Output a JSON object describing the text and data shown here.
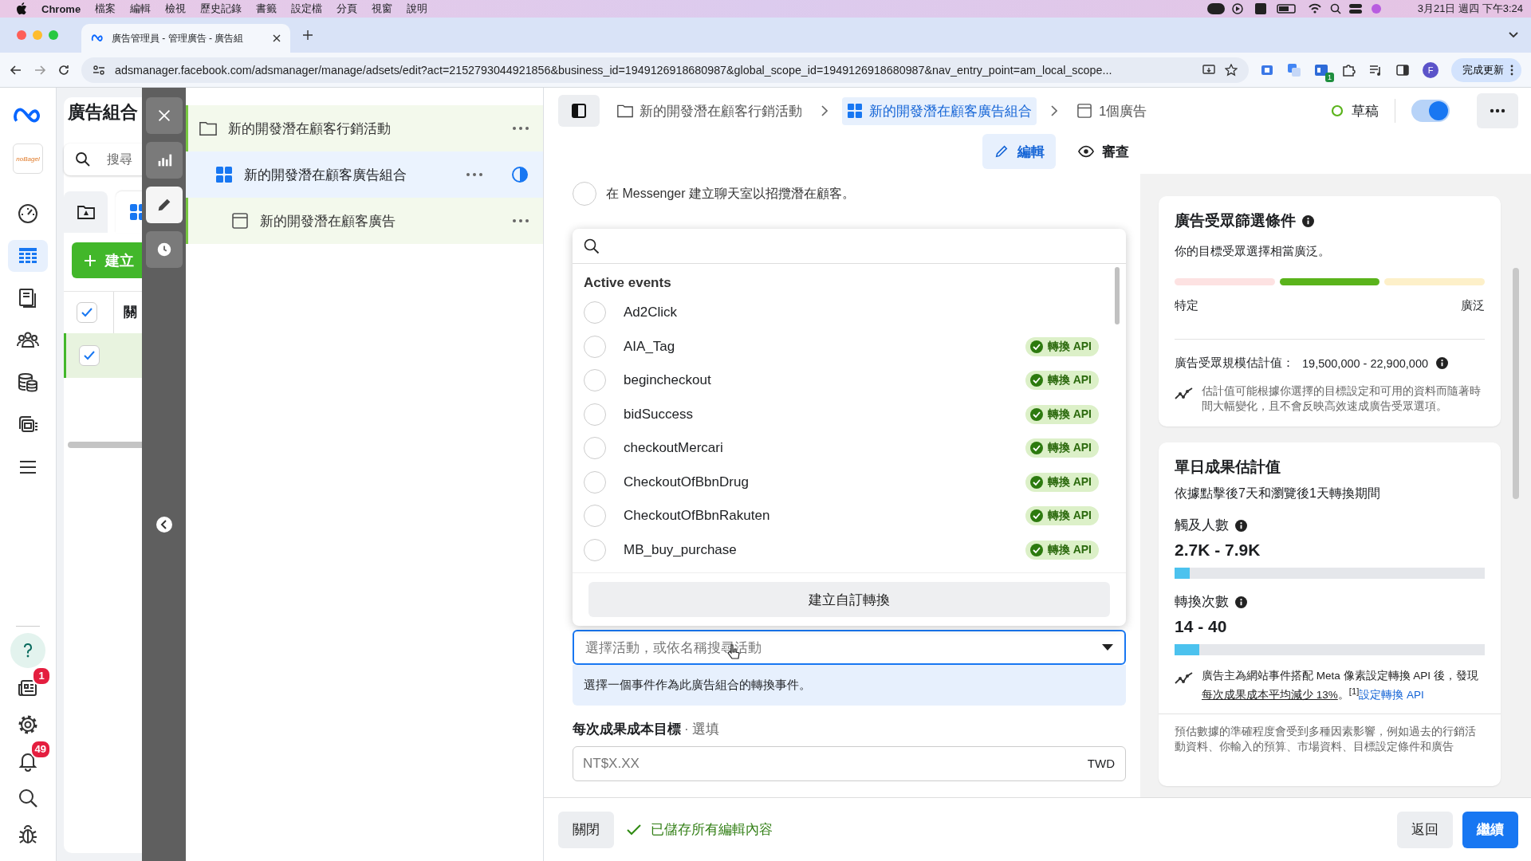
{
  "menu_bar": {
    "app": "Chrome",
    "menus": [
      "檔案",
      "編輯",
      "檢視",
      "歷史記錄",
      "書籤",
      "設定檔",
      "分頁",
      "視窗",
      "說明"
    ],
    "clock": "3月21日 週四 下午3:24"
  },
  "browser": {
    "tab_title": "廣告管理員 - 管理廣告 - 廣告組",
    "url": "adsmanager.facebook.com/adsmanager/manage/adsets/edit?act=2152793044921856&business_id=1949126918680987&global_scope_id=1949126918680987&nav_entry_point=am_local_scope...",
    "extension_badge": "1",
    "profile": "F",
    "update_button": "完成更新"
  },
  "left_nav": {
    "brand": "noBagel",
    "items": [
      {
        "kind": "dashboard",
        "selected": false
      },
      {
        "kind": "table",
        "selected": true
      },
      {
        "kind": "pages",
        "selected": false
      },
      {
        "kind": "audience",
        "selected": false
      },
      {
        "kind": "billing",
        "selected": false
      },
      {
        "kind": "media",
        "selected": false
      },
      {
        "kind": "menu",
        "selected": false
      }
    ],
    "bottom_items": [
      {
        "kind": "help"
      },
      {
        "kind": "news",
        "badge": "1"
      },
      {
        "kind": "settings"
      },
      {
        "kind": "notifications",
        "badge": "49"
      },
      {
        "kind": "search"
      },
      {
        "kind": "bug"
      }
    ]
  },
  "ads_panel": {
    "title": "廣告組合",
    "search_placeholder": "搜尋",
    "tabs": [
      {
        "kind": "folder",
        "selected": false
      },
      {
        "kind": "grid",
        "selected": true
      }
    ],
    "create_button": "建立",
    "header_checked": true,
    "column_header": "關",
    "rows": [
      {
        "checked": true
      }
    ]
  },
  "tool_rail": {
    "buttons": [
      {
        "kind": "close",
        "selected": false
      },
      {
        "kind": "chart",
        "selected": false
      },
      {
        "kind": "edit",
        "selected": true
      },
      {
        "kind": "history",
        "selected": false
      }
    ]
  },
  "tree": [
    {
      "kind": "campaign",
      "label": "新的開發潛在顧客行銷活動",
      "selected": false,
      "children": [
        {
          "kind": "adset",
          "label": "新的開發潛在顧客廣告組合",
          "selected": true,
          "children": [
            {
              "kind": "ad",
              "label": "新的開發潛在顧客廣告",
              "selected": false
            }
          ]
        }
      ]
    }
  ],
  "editor": {
    "breadcrumbs": [
      {
        "kind": "campaign",
        "label": "新的開發潛在顧客行銷活動",
        "selected": false
      },
      {
        "kind": "adset",
        "label": "新的開發潛在顧客廣告組合",
        "selected": true
      },
      {
        "kind": "ad",
        "label": "1個廣告",
        "selected": false
      }
    ],
    "status": "草稿",
    "toggle_on": true,
    "tabs": [
      {
        "kind": "edit",
        "label": "編輯",
        "selected": true
      },
      {
        "kind": "review",
        "label": "審查",
        "selected": false
      }
    ]
  },
  "form": {
    "option_checked": false,
    "option_description": "在 Messenger 建立聊天室以招攬潛在顧客。",
    "event_select": {
      "placeholder": "選擇活動，或依名稱搜尋活動",
      "help": "選擇一個事件作為此廣告組合的轉換事件。"
    },
    "cost_goal": {
      "label": "每次成果成本目標",
      "optional": "· 選填",
      "placeholder": "NT$X.XX",
      "currency": "TWD"
    }
  },
  "event_dropdown": {
    "section": "Active events",
    "events": [
      {
        "name": "Ad2Click",
        "selected": false
      },
      {
        "name": "AIA_Tag",
        "badge": "轉換 API",
        "selected": false
      },
      {
        "name": "begincheckout",
        "badge": "轉換 API",
        "selected": false
      },
      {
        "name": "bidSuccess",
        "badge": "轉換 API",
        "selected": false
      },
      {
        "name": "checkoutMercari",
        "badge": "轉換 API",
        "selected": false
      },
      {
        "name": "CheckoutOfBbnDrug",
        "badge": "轉換 API",
        "selected": false
      },
      {
        "name": "CheckoutOfBbnRakuten",
        "badge": "轉換 API",
        "selected": false
      },
      {
        "name": "MB_buy_purchase",
        "badge": "轉換 API",
        "selected": false
      }
    ],
    "create_button": "建立自訂轉換"
  },
  "audience_card": {
    "title": "廣告受眾篩選條件",
    "summary": "你的目標受眾選擇相當廣泛。",
    "segments": [
      {
        "selected": false
      },
      {
        "selected": true
      },
      {
        "selected": false
      }
    ],
    "low_label": "特定",
    "high_label": "廣泛",
    "size_label": "廣告受眾規模估計值：",
    "size_value": "19,500,000 - 22,900,000",
    "note": "估計值可能根據你選擇的目標設定和可用的資料而隨著時間大幅變化，且不會反映高效速成廣告受眾選項。"
  },
  "results_card": {
    "title": "單日成果估計值",
    "subtitle": "依據點擊後7天和瀏覽後1天轉換期間",
    "metrics": [
      {
        "label": "觸及人數",
        "value": "2.7K - 7.9K",
        "level": 0.05
      },
      {
        "label": "轉換次數",
        "value": "14 - 40",
        "level": 0.08
      }
    ],
    "tip": {
      "text_before": "廣告主為網站事件搭配 Meta 像素設定轉換 API 後，發現",
      "link": "每次成果成本平均減少 13%",
      "text_after": "。$^{[1]}$",
      "cta": "設定轉換 API"
    },
    "disclaimer": "預估數據的準確程度會受到多種因素影響，例如過去的行銷活動資料、你輸入的預算、市場資料、目標設定條件和廣告"
  },
  "footer": {
    "close": "關閉",
    "saved": "已儲存所有編輯內容",
    "back": "返回",
    "continue": "繼續"
  }
}
